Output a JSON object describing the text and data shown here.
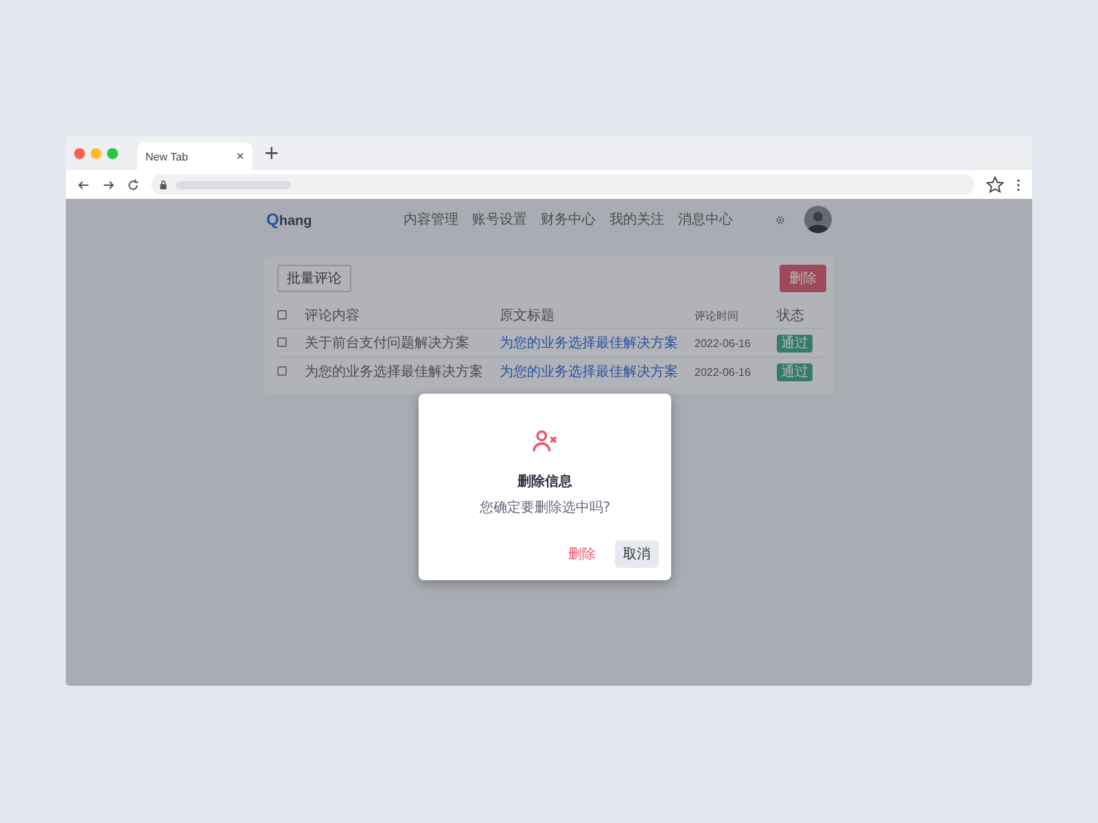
{
  "browser": {
    "tab_title": "New Tab",
    "close": "×",
    "new_tab": "+"
  },
  "header": {
    "logo_mark": "Q",
    "logo_name": "hang",
    "nav": [
      {
        "label": "内容管理",
        "selected": false
      },
      {
        "label": "账号设置",
        "selected": false
      },
      {
        "label": "财务中心",
        "selected": false
      },
      {
        "label": "我的关注",
        "selected": false
      },
      {
        "label": "消息中心",
        "selected": false
      }
    ]
  },
  "toolbar": {
    "batch_button": "批量评论",
    "delete_button": "删除"
  },
  "table": {
    "header_checked": false,
    "columns": [
      "评论内容",
      "原文标题",
      "评论时间",
      "状态"
    ],
    "rows": [
      {
        "checked": false,
        "content": "关于前台支付问题解决方案",
        "title": "为您的业务选择最佳解决方案",
        "time": "2022-06-16",
        "status": "通过"
      },
      {
        "checked": false,
        "content": "为您的业务选择最佳解决方案",
        "title": "为您的业务选择最佳解决方案",
        "time": "2022-06-16",
        "status": "通过"
      }
    ]
  },
  "dialog": {
    "title": "删除信息",
    "message": "您确定要删除选中吗?",
    "confirm": "删除",
    "cancel": "取消"
  }
}
